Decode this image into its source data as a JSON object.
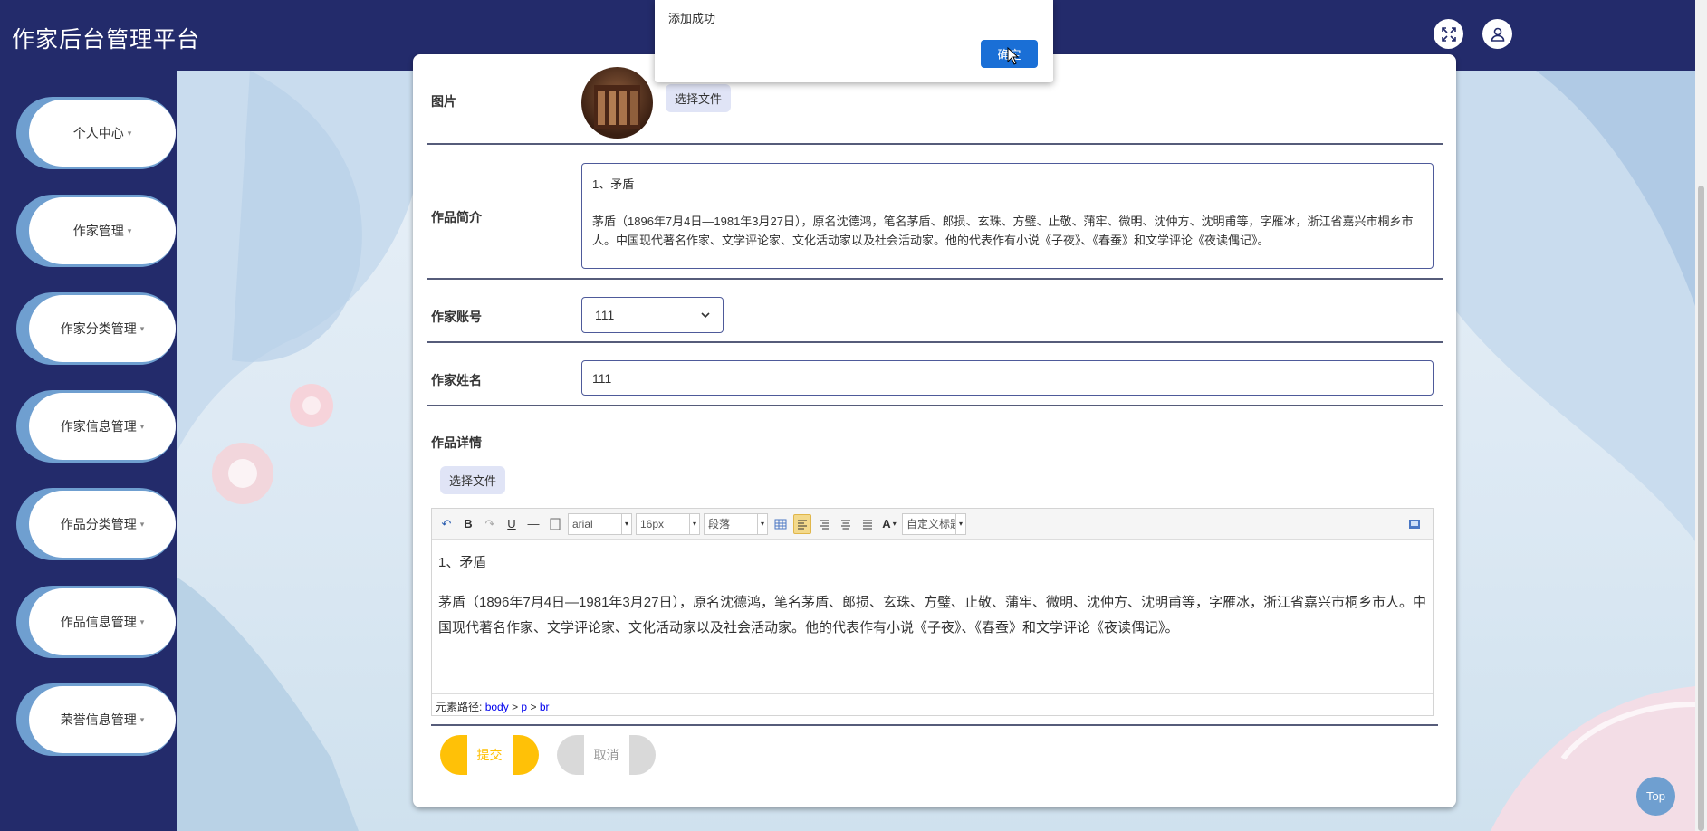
{
  "app": {
    "title": "作家后台管理平台"
  },
  "header": {
    "fullscreen_icon": "fullscreen-icon",
    "user_icon": "user-icon"
  },
  "sidebar": {
    "items": [
      {
        "label": "个人中心"
      },
      {
        "label": "作家管理"
      },
      {
        "label": "作家分类管理"
      },
      {
        "label": "作家信息管理"
      },
      {
        "label": "作品分类管理"
      },
      {
        "label": "作品信息管理"
      },
      {
        "label": "荣誉信息管理"
      }
    ],
    "caret": "▾"
  },
  "form": {
    "image_label": "图片",
    "choose_file": "选择文件",
    "intro_label": "作品简介",
    "intro_line1": "1、矛盾",
    "intro_line2": "茅盾（1896年7月4日—1981年3月27日），原名沈德鸿，笔名茅盾、郎损、玄珠、方璧、止敬、蒲牢、微明、沈仲方、沈明甫等，字雁冰，浙江省嘉兴市桐乡市人。中国现代著名作家、文学评论家、文化活动家以及社会活动家。他的代表作有小说《子夜》、《春蚕》和文学评论《夜读偶记》。",
    "account_label": "作家账号",
    "account_value": "111",
    "name_label": "作家姓名",
    "name_value": "111",
    "detail_label": "作品详情",
    "detail_choose_file": "选择文件"
  },
  "editor": {
    "font_family": "arial",
    "font_size": "16px",
    "paragraph": "段落",
    "custom_title": "自定义标题",
    "body_line1": "1、矛盾",
    "body_line2": "茅盾（1896年7月4日—1981年3月27日），原名沈德鸿，笔名茅盾、郎损、玄珠、方璧、止敬、蒲牢、微明、沈仲方、沈明甫等，字雁冰，浙江省嘉兴市桐乡市人。中国现代著名作家、文学评论家、文化活动家以及社会活动家。他的代表作有小说《子夜》、《春蚕》和文学评论《夜读偶记》。",
    "path_label": "元素路径:",
    "path_body": "body",
    "path_p": "p",
    "path_br": "br",
    "path_sep": ">"
  },
  "actions": {
    "submit": "提交",
    "cancel": "取消",
    "submit_color": "#ffc107",
    "cancel_color": "#d9d9d9"
  },
  "dialog": {
    "message": "添加成功",
    "ok_button": "确定"
  },
  "float_top": "Top",
  "colors": {
    "header": "#232b6b",
    "accent": "#6f9fd0",
    "primary_button": "#1a6fd6"
  }
}
